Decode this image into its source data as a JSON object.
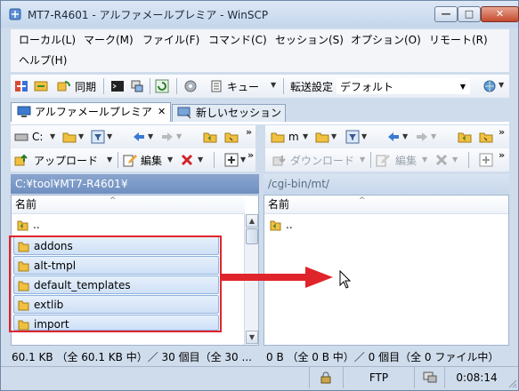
{
  "window": {
    "title": "MT7-R4601 - アルファメールプレミア - WinSCP",
    "min_label": "—",
    "max_label": "□",
    "close_label": "✕"
  },
  "menu": {
    "items": [
      "ローカル(L)",
      "マーク(M)",
      "ファイル(F)",
      "コマンド(C)",
      "セッション(S)",
      "オプション(O)",
      "リモート(R)",
      "ヘルプ(H)"
    ]
  },
  "toolbar": {
    "sync_label": "同期",
    "queue_label": "キュー",
    "transfer_label": "転送設定",
    "transfer_value": "デフォルト"
  },
  "tabs": {
    "active": "アルファメールプレミア",
    "active_close": "✕",
    "new_session": "新しいセッション"
  },
  "left": {
    "drive": "C:",
    "upload_label": "アップロード",
    "edit_label": "編集",
    "path": "C:¥tool¥MT7-R4601¥",
    "col_name": "名前",
    "up_label": "..",
    "files": [
      "addons",
      "alt-tmpl",
      "default_templates",
      "extlib",
      "import"
    ],
    "status": "60.1 KB （全 60.1 KB 中）／ 30 個目（全 30 ..."
  },
  "right": {
    "drive": "m",
    "download_label": "ダウンロード",
    "edit_label": "編集",
    "path": "/cgi-bin/mt/",
    "col_name": "名前",
    "up_label": "..",
    "status": "0 B （全 0 B 中）／ 0 個目（全 0 ファイル中）"
  },
  "statusbar": {
    "protocol": "FTP",
    "time": "0:08:14"
  },
  "colors": {
    "highlight_box": "#e0242b",
    "arrow": "#e0242b"
  }
}
